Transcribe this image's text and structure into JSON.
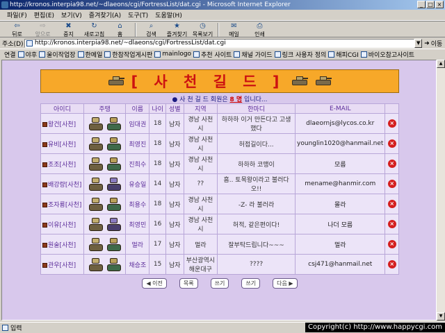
{
  "window": {
    "title": "http://kronos.interpia98.net/~dlaeons/cgi/FortressList/dat.cgi - Microsoft Internet Explorer"
  },
  "menu": [
    "파일(F)",
    "편집(E)",
    "보기(V)",
    "즐겨찾기(A)",
    "도구(T)",
    "도움말(H)"
  ],
  "toolbar": {
    "back": "뒤로",
    "forward": "앞으로",
    "stop": "중지",
    "refresh": "새로고침",
    "home": "홈",
    "search": "검색",
    "favorites": "즐겨찾기",
    "history": "목록보기",
    "mail": "메일",
    "print": "인쇄"
  },
  "address": {
    "label": "주소(D)",
    "value": "http://kronos.interpia98.net/~dlaeons/cgi/FortressList/dat.cgi",
    "go": "이동"
  },
  "links": {
    "label": "연결",
    "items": [
      "야후",
      "울이작업장",
      "한메일",
      "한참작업게시판",
      "mainlogo",
      "추천 사이트",
      "채널 가이드",
      "링크 사용자 정의",
      "해피CGI",
      "바이오참고사이트"
    ]
  },
  "page": {
    "title": "[ 사 천 길 드 ]",
    "count_prefix": "● 사 천 길 드 회원은 ",
    "count_value": "8 명",
    "count_suffix": " 입니다...",
    "columns": [
      "아이디",
      "주탱",
      "이름",
      "나이",
      "성별",
      "지역",
      "한마디",
      "E-MAIL",
      ""
    ],
    "rows": [
      {
        "id": "왕건[사천]",
        "name": "임대권",
        "age": "18",
        "gender": "남자",
        "region": "경남 사천시",
        "remark": "하하하 이거 만든다고 고생했다",
        "email": "dlaeornjs@lycos.co.kr",
        "u1": "u-a",
        "u2": "u-b"
      },
      {
        "id": "유비[사천]",
        "name": "최영진",
        "age": "18",
        "gender": "남자",
        "region": "경남 사천시",
        "remark": "허접길이다...",
        "email": "younglin1020@hanmail.net",
        "u1": "u-a",
        "u2": "u-b"
      },
      {
        "id": "조조[사천]",
        "name": "진희수",
        "age": "18",
        "gender": "남자",
        "region": "경남 사천시",
        "remark": "하하하 코맹이",
        "email": "모름",
        "u1": "u-a",
        "u2": "u-b"
      },
      {
        "id": "배강량[사천]",
        "name": "유승일",
        "age": "14",
        "gender": "남자",
        "region": "??",
        "remark": "흠.. 토목왕이라고 불러다오!!",
        "email": "mename@hanmir.com",
        "u1": "u-a",
        "u2": "u-c"
      },
      {
        "id": "조자룡[사천]",
        "name": "최용수",
        "age": "18",
        "gender": "남자",
        "region": "경남 사천시",
        "remark": "-Z- 라 불러라",
        "email": "몰라",
        "u1": "u-a",
        "u2": "u-b"
      },
      {
        "id": "이유[사천]",
        "name": "최영민",
        "age": "16",
        "gender": "남자",
        "region": "경남 사천시",
        "remark": "허적, 같은편이다!",
        "email": "나더 모름",
        "u1": "u-a",
        "u2": "u-c"
      },
      {
        "id": "원술[사천]",
        "name": "멀라",
        "age": "17",
        "gender": "남자",
        "region": "멀라",
        "remark": "잘부탁드립니다~~~",
        "email": "멀라",
        "u1": "u-a",
        "u2": "u-b"
      },
      {
        "id": "관우[사천]",
        "name": "채승조",
        "age": "15",
        "gender": "남자",
        "region": "부산광역시 해운대구",
        "remark": "????",
        "email": "csj471@hanmail.net",
        "u1": "u-a",
        "u2": "u-b"
      }
    ],
    "pager": [
      "◀ 이전",
      "목록",
      "쓰기",
      "쓰기",
      "다음 ▶"
    ]
  },
  "status": {
    "text": "입력",
    "copyright": "Copyright(c) http://www.happycgi.com"
  }
}
